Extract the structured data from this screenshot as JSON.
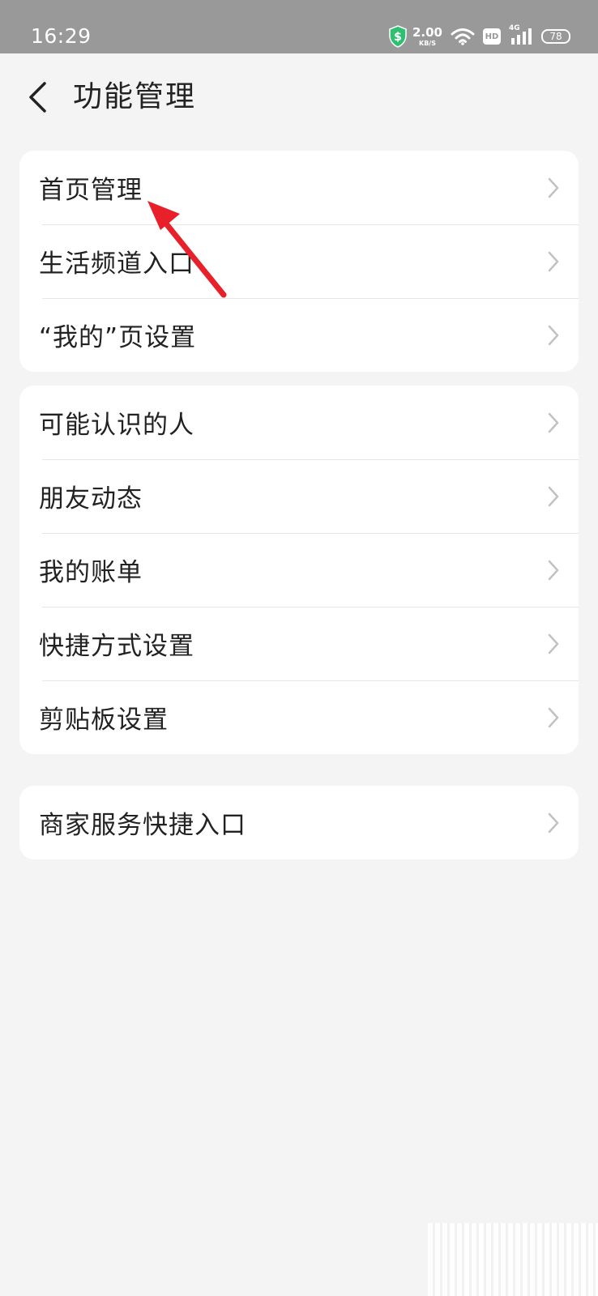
{
  "status_bar": {
    "time": "16:29",
    "speed_value": "2.00",
    "speed_unit": "KB/S",
    "hd_label": "HD",
    "network_type": "4G",
    "battery_level": "78",
    "icons": [
      "shield-icon",
      "wifi-icon",
      "hd-icon",
      "cellular-signal-icon",
      "battery-icon"
    ]
  },
  "header": {
    "title": "功能管理",
    "back_icon": "chevron-left-icon"
  },
  "groups": [
    {
      "items": [
        {
          "label": "首页管理"
        },
        {
          "label": "生活频道入口"
        },
        {
          "label": "“我的”页设置"
        }
      ]
    },
    {
      "items": [
        {
          "label": "可能认识的人"
        },
        {
          "label": "朋友动态"
        },
        {
          "label": "我的账单"
        },
        {
          "label": "快捷方式设置"
        },
        {
          "label": "剪贴板设置"
        }
      ]
    },
    {
      "items": [
        {
          "label": "商家服务快捷入口"
        }
      ]
    }
  ],
  "colors": {
    "background": "#f4f4f4",
    "card": "#ffffff",
    "text": "#222222",
    "chevron": "#c2c2c2",
    "divider": "#e6e6e6",
    "status_bar": "#999999",
    "annotation_arrow": "#e8202a",
    "shield_accent": "#2fbf71"
  }
}
